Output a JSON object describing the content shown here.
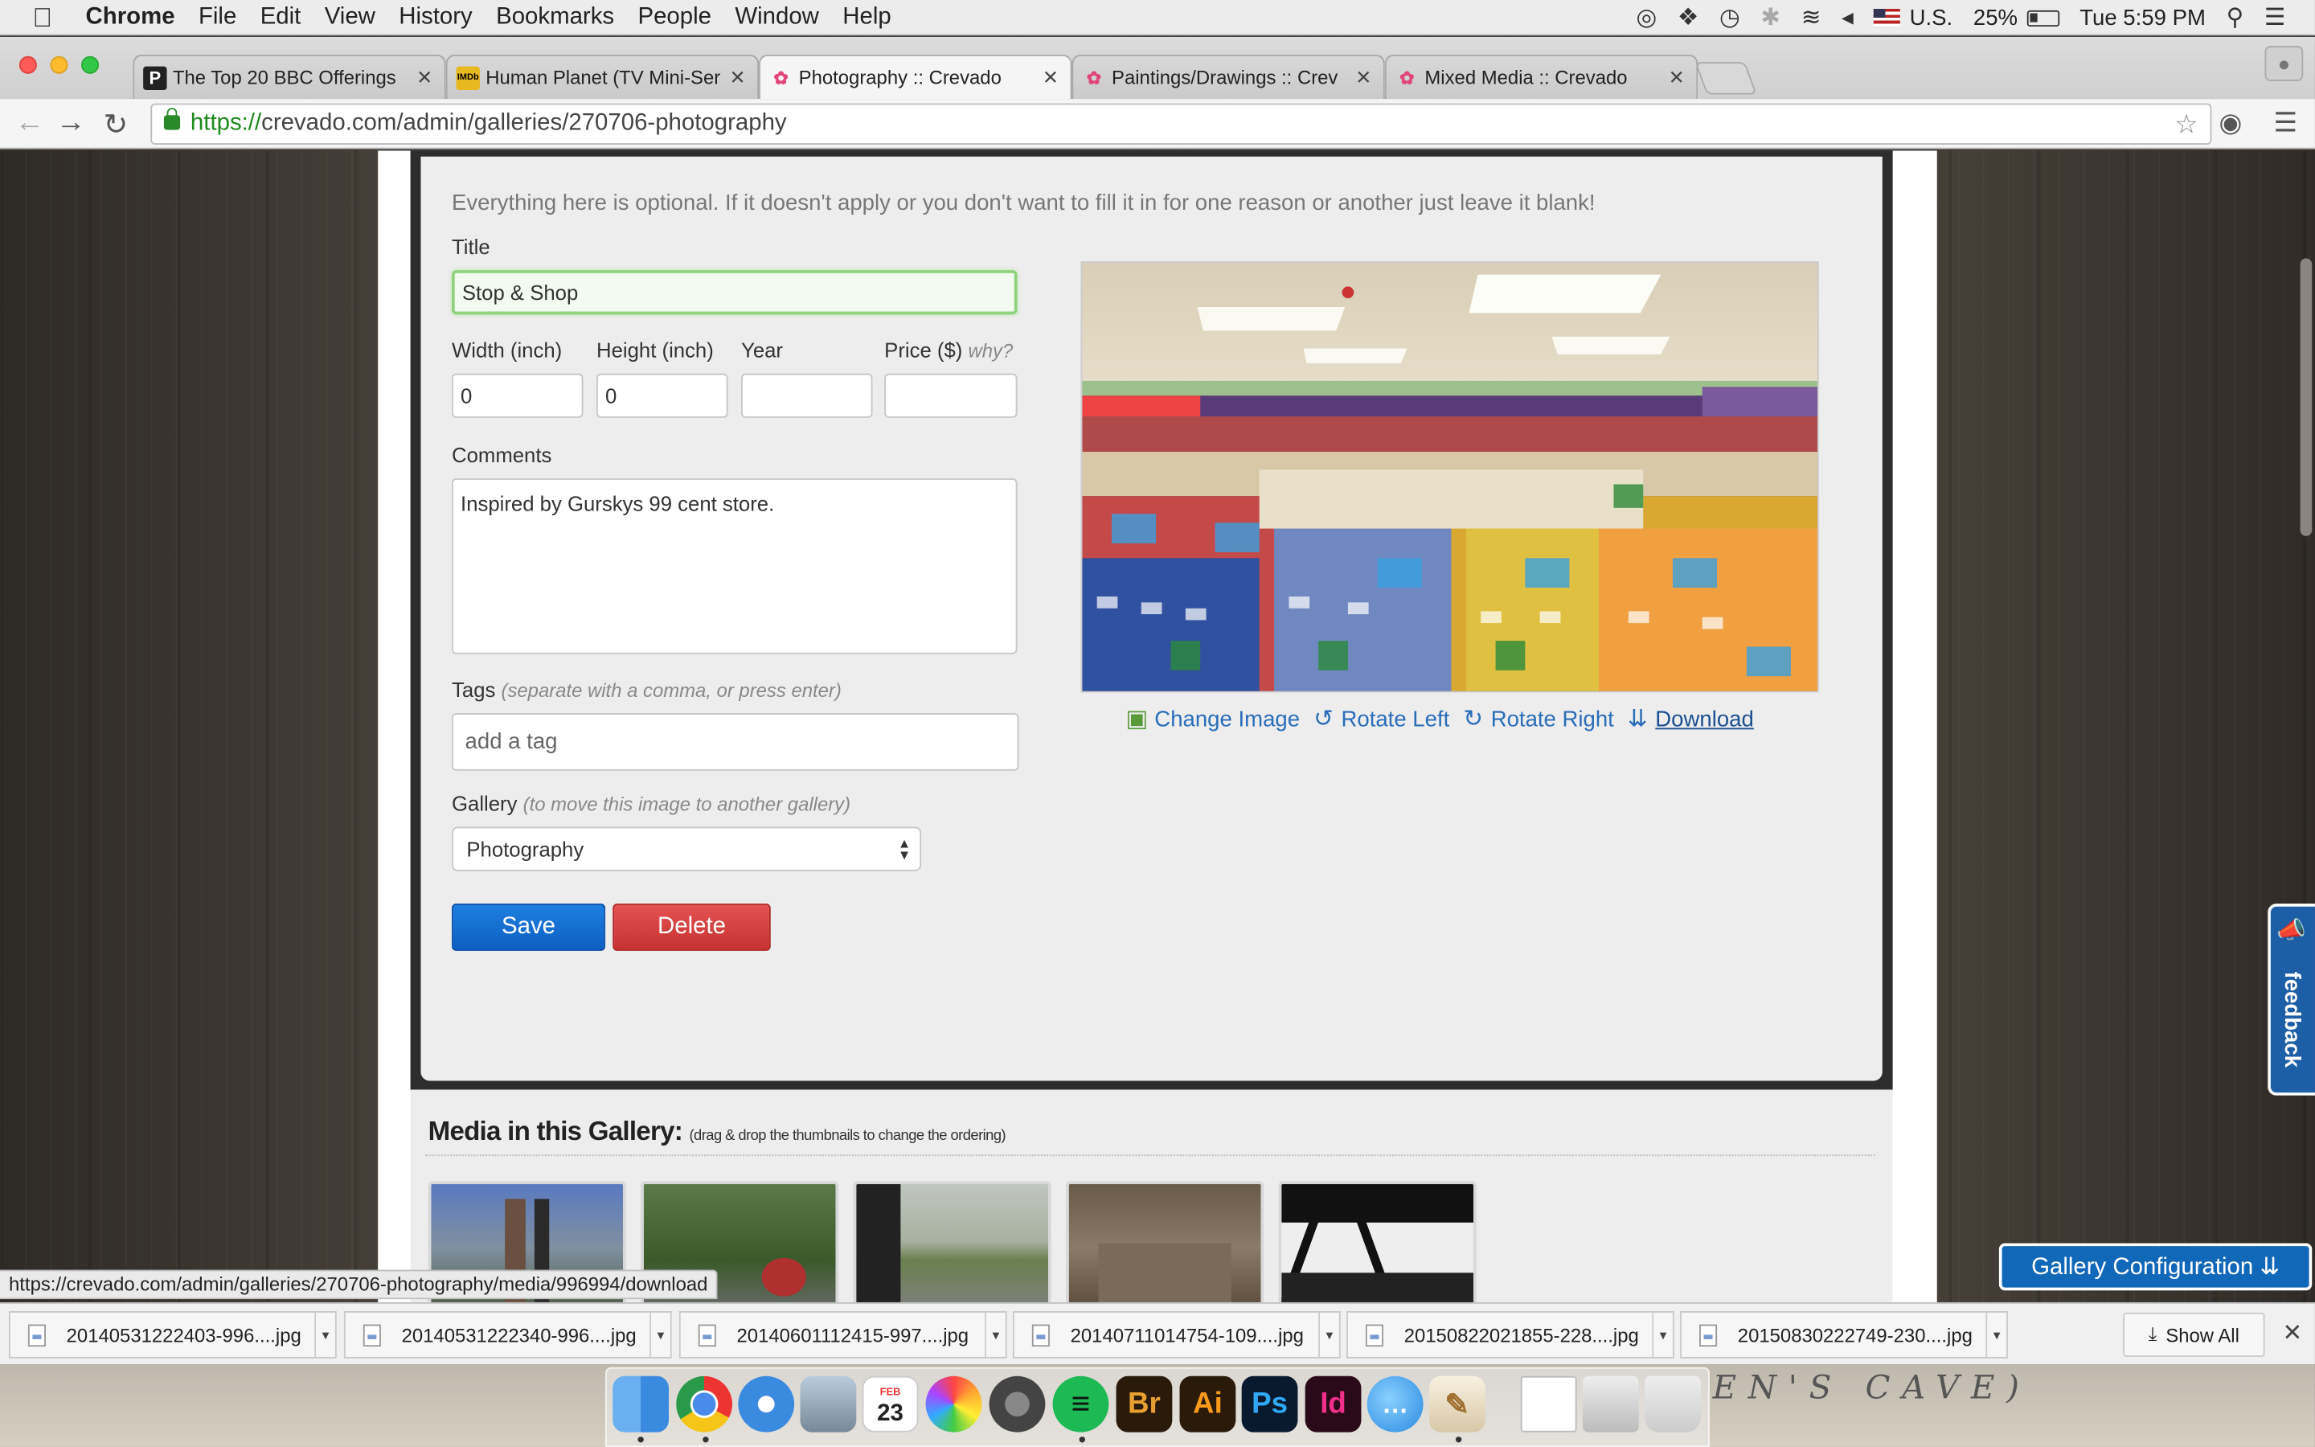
{
  "menubar": {
    "app": "Chrome",
    "menus": [
      "File",
      "Edit",
      "View",
      "History",
      "Bookmarks",
      "People",
      "Window",
      "Help"
    ],
    "input_source": "U.S.",
    "battery": "25%",
    "clock": "Tue 5:59 PM"
  },
  "tabs": [
    {
      "label": "The Top 20 BBC Offerings",
      "icon": "P"
    },
    {
      "label": "Human Planet (TV Mini-Ser",
      "icon": "IMDb"
    },
    {
      "label": "Photography :: Crevado",
      "icon": "crevado"
    },
    {
      "label": "Paintings/Drawings :: Crev",
      "icon": "crevado"
    },
    {
      "label": "Mixed Media :: Crevado",
      "icon": "crevado"
    }
  ],
  "url": {
    "scheme": "https://",
    "rest": "crevado.com/admin/galleries/270706-photography"
  },
  "form": {
    "intro": "Everything here is optional. If it doesn't apply or you don't want to fill it in for one reason or another just leave it blank!",
    "title_label": "Title",
    "title_value": "Stop & Shop",
    "width_label": "Width (inch)",
    "width_value": "0",
    "height_label": "Height (inch)",
    "height_value": "0",
    "year_label": "Year",
    "year_value": "",
    "price_label": "Price ($)",
    "price_hint": "why?",
    "price_value": "",
    "comments_label": "Comments",
    "comments_value": "Inspired by Gurskys 99 cent store.",
    "tags_label": "Tags",
    "tags_hint": "(separate with a comma, or press enter)",
    "tags_placeholder": "add a tag",
    "gallery_label": "Gallery",
    "gallery_hint": "(to move this image to another gallery)",
    "gallery_value": "Photography",
    "save": "Save",
    "delete": "Delete"
  },
  "image_actions": {
    "change": "Change Image",
    "rotate_left": "Rotate Left",
    "rotate_right": "Rotate Right",
    "download": "Download"
  },
  "media": {
    "heading": "Media in this Gallery:",
    "hint": "(drag & drop the thumbnails to change the ordering)"
  },
  "feedback": "feedback",
  "gallery_config": "Gallery Configuration ⇊",
  "status_url": "https://crevado.com/admin/galleries/270706-photography/media/996994/download",
  "downloads": [
    "20140531222403-996....jpg",
    "20140531222340-996....jpg",
    "20140601112415-997....jpg",
    "20140711014754-109....jpg",
    "20150822021855-228....jpg",
    "20150830222749-230....jpg"
  ],
  "show_all": "Show All",
  "dock": {
    "calendar_month": "FEB",
    "calendar_day": "23",
    "background_text": "EN'S CAVE)"
  }
}
